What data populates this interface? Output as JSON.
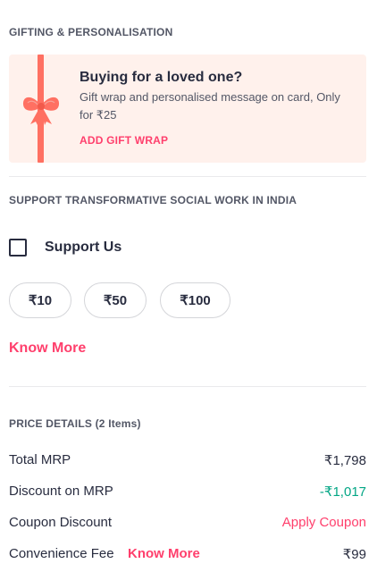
{
  "gifting": {
    "section_title": "GIFTING & PERSONALISATION",
    "heading": "Buying for a loved one?",
    "description": "Gift wrap and personalised message on card, Only for ₹25",
    "add_gift_wrap": "ADD GIFT WRAP",
    "icon": "gift-bow-icon",
    "background_color": "#fff1ec",
    "ribbon_color": "#ff7062"
  },
  "social": {
    "section_title": "SUPPORT TRANSFORMATIVE SOCIAL WORK IN INDIA",
    "support_label": "Support Us",
    "support_checked": false,
    "amounts": [
      "₹10",
      "₹50",
      "₹100"
    ],
    "know_more": "Know More"
  },
  "price_details": {
    "section_title": "PRICE DETAILS (2 Items)",
    "rows": [
      {
        "label": "Total MRP",
        "value": "₹1,798"
      },
      {
        "label": "Discount on MRP",
        "value": "-₹1,017"
      },
      {
        "label": "Coupon Discount",
        "value": "Apply Coupon"
      },
      {
        "label": "Convenience Fee",
        "link": "Know More",
        "value": "₹99"
      }
    ]
  },
  "colors": {
    "accent": "#ff3f6c",
    "discount_green": "#03a685",
    "text": "#282c3f",
    "muted": "#535766"
  }
}
